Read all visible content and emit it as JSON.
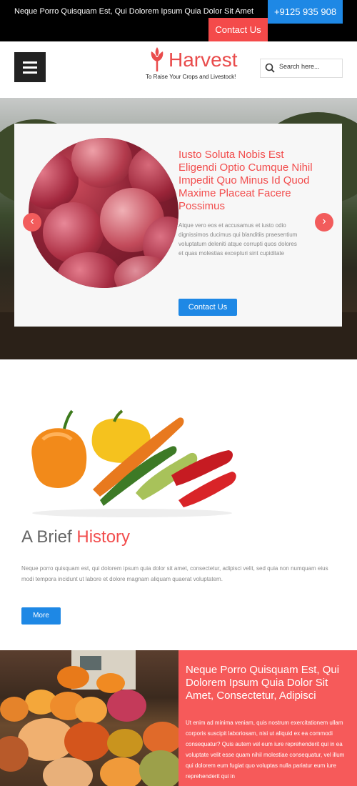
{
  "topbar": {
    "text": "Neque Porro Quisquam Est, Qui Dolorem Ipsum Quia Dolor Sit Amet",
    "phone": "+9125 935 908",
    "contact": "Contact Us"
  },
  "header": {
    "logo": "Harvest",
    "tagline": "To Raise Your Crops and Livestock!",
    "search_placeholder": "Search here...",
    "menu_icon": "hamburger-icon",
    "search_icon": "search-icon"
  },
  "slider": {
    "title": "Iusto Soluta Nobis Est Eligendi Optio Cumque Nihil Impedit Quo Minus Id Quod Maxime Placeat Facere Possimus",
    "text": "Atque vero eos et accusamus et iusto odio dignissimos ducimus qui blanditiis praesentium voluptatum deleniti atque corrupti quos dolores et quas molestias excepturi sint cupiditate",
    "button": "Contact Us",
    "prev": "‹",
    "next": "›"
  },
  "history": {
    "title_a": "A Brief",
    "title_b": "History",
    "text": "Neque porro quisquam est, qui dolorem ipsum quia dolor sit amet, consectetur, adipisci velit, sed quia non numquam eius modi tempora incidunt ut labore et dolore magnam aliquam quaerat voluptatem.",
    "button": "More"
  },
  "feature": {
    "title": "Neque Porro Quisquam Est, Qui Dolorem Ipsum Quia Dolor Sit Amet, Consectetur, Adipisci",
    "text": "Ut enim ad minima veniam, quis nostrum exercitationem ullam corporis suscipit laboriosam, nisi ut aliquid ex ea commodi consequatur? Quis autem vel eum iure reprehenderit qui in ea voluptate velit esse quam nihil molestiae consequatur, vel illum qui dolorem eum fugiat quo voluptas nulla pariatur eum iure reprehenderit qui in"
  },
  "colors": {
    "accent": "#f24d4d",
    "blue": "#1e88e5"
  }
}
